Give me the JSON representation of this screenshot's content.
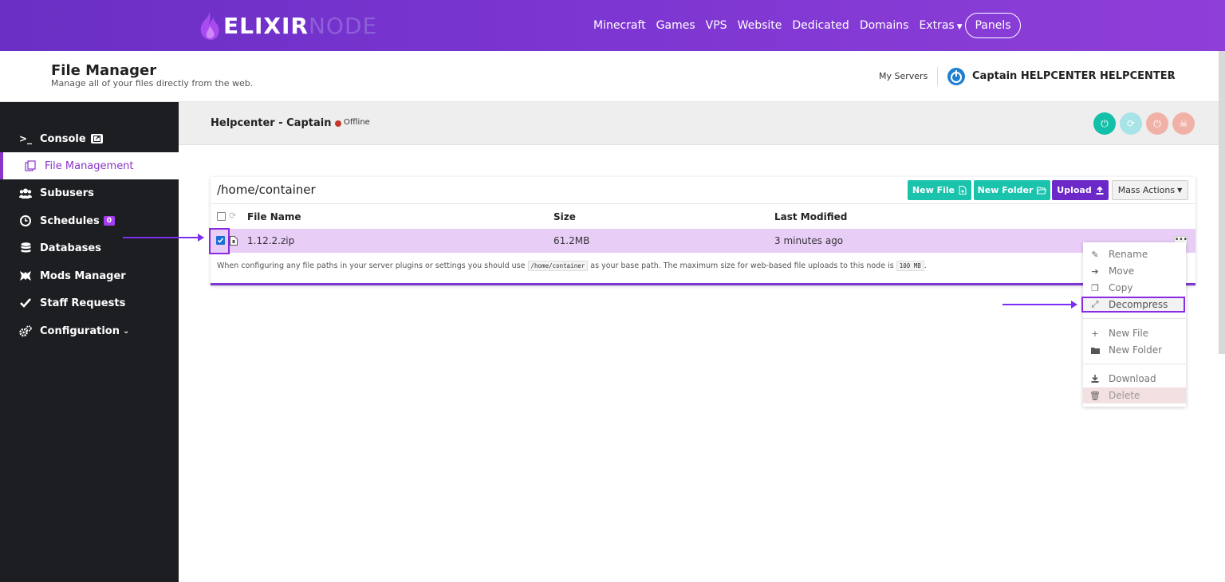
{
  "brand": {
    "part1": "ELIXIR",
    "part2": "NODE"
  },
  "nav": {
    "items": [
      "Minecraft",
      "Games",
      "VPS",
      "Website",
      "Dedicated",
      "Domains",
      "Extras"
    ],
    "panels_label": "Panels"
  },
  "header": {
    "title": "File Manager",
    "subtitle": "Manage all of your files directly from the web.",
    "my_servers": "My Servers",
    "user_name": "Captain HELPCENTER HELPCENTER"
  },
  "sidebar": {
    "items": [
      {
        "label": "Console",
        "icon": "terminal-icon"
      },
      {
        "label": "File Management",
        "icon": "files-icon"
      },
      {
        "label": "Subusers",
        "icon": "users-icon"
      },
      {
        "label": "Schedules",
        "icon": "clock-icon",
        "badge": "0"
      },
      {
        "label": "Databases",
        "icon": "database-icon"
      },
      {
        "label": "Mods Manager",
        "icon": "mods-icon"
      },
      {
        "label": "Staff Requests",
        "icon": "check-icon"
      },
      {
        "label": "Configuration",
        "icon": "gears-icon"
      }
    ]
  },
  "server": {
    "name": "Helpcenter - Captain",
    "status": "Offline"
  },
  "files": {
    "path": "/home/container",
    "buttons": {
      "new_file": "New File",
      "new_folder": "New Folder",
      "upload": "Upload",
      "mass_actions": "Mass Actions"
    },
    "columns": {
      "name": "File Name",
      "size": "Size",
      "modified": "Last Modified"
    },
    "rows": [
      {
        "name": "1.12.2.zip",
        "size": "61.2MB",
        "modified": "3 minutes ago",
        "checked": true
      }
    ],
    "note_before": "When configuring any file paths in your server plugins or settings you should use",
    "note_path": "/home/container",
    "note_middle": "as your base path. The maximum size for web-based file uploads to this node is",
    "note_limit": "100 MB",
    "note_end": "."
  },
  "context_menu": {
    "items": [
      "Rename",
      "Move",
      "Copy",
      "Decompress",
      "New File",
      "New Folder",
      "Download",
      "Delete"
    ],
    "selected": "Decompress"
  },
  "colors": {
    "brand_purple": "#7b35d1",
    "teal": "#1bc3ad",
    "row_highlight": "#e8cdf7",
    "offline": "#c0392b",
    "annotation": "#8a2be2"
  }
}
